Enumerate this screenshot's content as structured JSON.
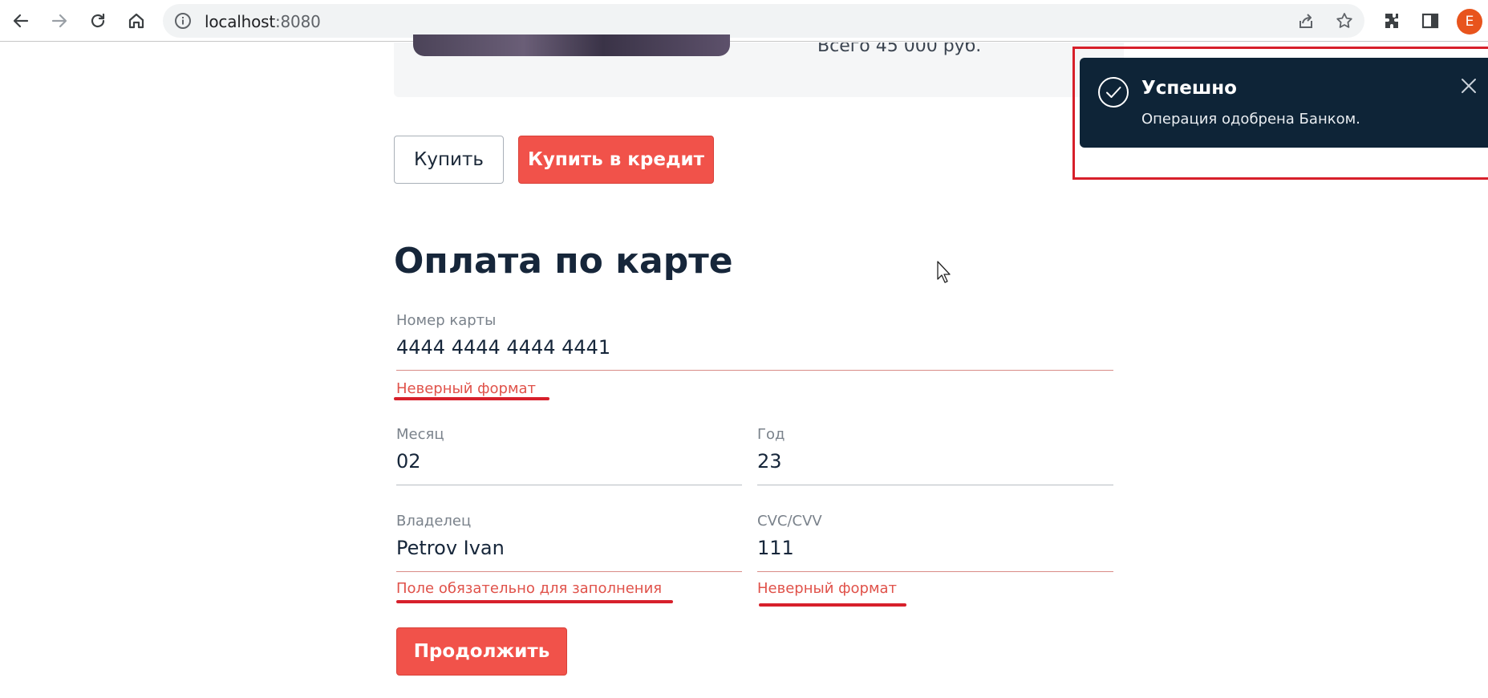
{
  "browser": {
    "back_icon": "arrow-left-icon",
    "forward_icon": "arrow-right-icon",
    "reload_icon": "reload-icon",
    "home_icon": "home-icon",
    "url_host": "localhost",
    "url_port": ":8080",
    "avatar_letter": "E"
  },
  "product": {
    "total_text": "Всего 45 000 руб."
  },
  "actions": {
    "buy_label": "Купить",
    "buy_credit_label": "Купить в кредит"
  },
  "payment": {
    "title": "Оплата по карте",
    "card_number": {
      "label": "Номер карты",
      "value": "4444 4444 4444 4441",
      "error": "Неверный формат"
    },
    "month": {
      "label": "Месяц",
      "value": "02"
    },
    "year": {
      "label": "Год",
      "value": "23"
    },
    "owner": {
      "label": "Владелец",
      "value": "Petrov Ivan",
      "error": "Поле обязательно для заполнения"
    },
    "cvc": {
      "label": "CVC/CVV",
      "value": "111",
      "error": "Неверный формат"
    },
    "continue_label": "Продолжить"
  },
  "toast": {
    "title": "Успешно",
    "message": "Операция одобрена Банком.",
    "status_color": "#0e2437"
  },
  "colors": {
    "accent": "#f1524a",
    "error": "#e0524a",
    "annotation": "#d7202b"
  }
}
